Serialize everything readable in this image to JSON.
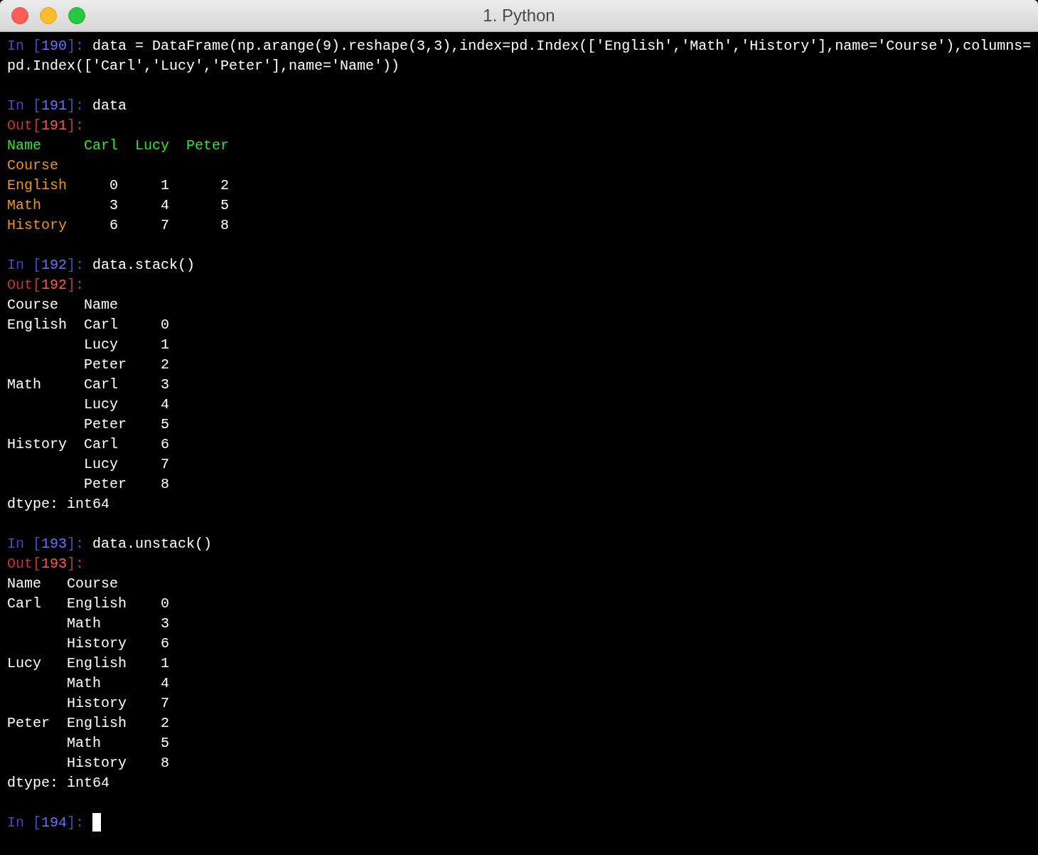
{
  "window": {
    "title": "1. Python"
  },
  "lines": [
    {
      "kind": "input",
      "prompt": [
        "In [",
        "190",
        "]:"
      ],
      "segments": [
        {
          "kind": "code",
          "text": "data = DataFrame(np.arange(9).reshape(3,3),index=pd.Index(['English','Math','History'],name='Course'),columns="
        }
      ]
    },
    {
      "kind": "text",
      "segments": [
        {
          "kind": "code",
          "text": "pd.Index(['Carl','Lucy','Peter'],name='Name'))"
        }
      ]
    },
    {
      "kind": "blank"
    },
    {
      "kind": "input",
      "prompt": [
        "In [",
        "191",
        "]:"
      ],
      "segments": [
        {
          "kind": "code",
          "text": "data"
        }
      ]
    },
    {
      "kind": "output",
      "prompt": [
        "Out[",
        "191",
        "]:"
      ]
    },
    {
      "kind": "text",
      "segments": [
        {
          "kind": "header",
          "text": "Name     Carl  Lucy  Peter"
        }
      ]
    },
    {
      "kind": "text",
      "segments": [
        {
          "kind": "index",
          "text": "Course"
        }
      ]
    },
    {
      "kind": "text",
      "segments": [
        {
          "kind": "index",
          "text": "English"
        },
        {
          "kind": "plain",
          "text": "     0     1      2"
        }
      ]
    },
    {
      "kind": "text",
      "segments": [
        {
          "kind": "index",
          "text": "Math"
        },
        {
          "kind": "plain",
          "text": "        3     4      5"
        }
      ]
    },
    {
      "kind": "text",
      "segments": [
        {
          "kind": "index",
          "text": "History"
        },
        {
          "kind": "plain",
          "text": "     6     7      8"
        }
      ]
    },
    {
      "kind": "blank"
    },
    {
      "kind": "input",
      "prompt": [
        "In [",
        "192",
        "]:"
      ],
      "segments": [
        {
          "kind": "code",
          "text": "data.stack()"
        }
      ]
    },
    {
      "kind": "output",
      "prompt": [
        "Out[",
        "192",
        "]:"
      ]
    },
    {
      "kind": "text",
      "segments": [
        {
          "kind": "plain",
          "text": "Course   Name"
        }
      ]
    },
    {
      "kind": "text",
      "segments": [
        {
          "kind": "plain",
          "text": "English  Carl     0"
        }
      ]
    },
    {
      "kind": "text",
      "segments": [
        {
          "kind": "plain",
          "text": "         Lucy     1"
        }
      ]
    },
    {
      "kind": "text",
      "segments": [
        {
          "kind": "plain",
          "text": "         Peter    2"
        }
      ]
    },
    {
      "kind": "text",
      "segments": [
        {
          "kind": "plain",
          "text": "Math     Carl     3"
        }
      ]
    },
    {
      "kind": "text",
      "segments": [
        {
          "kind": "plain",
          "text": "         Lucy     4"
        }
      ]
    },
    {
      "kind": "text",
      "segments": [
        {
          "kind": "plain",
          "text": "         Peter    5"
        }
      ]
    },
    {
      "kind": "text",
      "segments": [
        {
          "kind": "plain",
          "text": "History  Carl     6"
        }
      ]
    },
    {
      "kind": "text",
      "segments": [
        {
          "kind": "plain",
          "text": "         Lucy     7"
        }
      ]
    },
    {
      "kind": "text",
      "segments": [
        {
          "kind": "plain",
          "text": "         Peter    8"
        }
      ]
    },
    {
      "kind": "text",
      "segments": [
        {
          "kind": "plain",
          "text": "dtype: int64"
        }
      ]
    },
    {
      "kind": "blank"
    },
    {
      "kind": "input",
      "prompt": [
        "In [",
        "193",
        "]:"
      ],
      "segments": [
        {
          "kind": "code",
          "text": "data.unstack()"
        }
      ]
    },
    {
      "kind": "output",
      "prompt": [
        "Out[",
        "193",
        "]:"
      ]
    },
    {
      "kind": "text",
      "segments": [
        {
          "kind": "plain",
          "text": "Name   Course"
        }
      ]
    },
    {
      "kind": "text",
      "segments": [
        {
          "kind": "plain",
          "text": "Carl   English    0"
        }
      ]
    },
    {
      "kind": "text",
      "segments": [
        {
          "kind": "plain",
          "text": "       Math       3"
        }
      ]
    },
    {
      "kind": "text",
      "segments": [
        {
          "kind": "plain",
          "text": "       History    6"
        }
      ]
    },
    {
      "kind": "text",
      "segments": [
        {
          "kind": "plain",
          "text": "Lucy   English    1"
        }
      ]
    },
    {
      "kind": "text",
      "segments": [
        {
          "kind": "plain",
          "text": "       Math       4"
        }
      ]
    },
    {
      "kind": "text",
      "segments": [
        {
          "kind": "plain",
          "text": "       History    7"
        }
      ]
    },
    {
      "kind": "text",
      "segments": [
        {
          "kind": "plain",
          "text": "Peter  English    2"
        }
      ]
    },
    {
      "kind": "text",
      "segments": [
        {
          "kind": "plain",
          "text": "       Math       5"
        }
      ]
    },
    {
      "kind": "text",
      "segments": [
        {
          "kind": "plain",
          "text": "       History    8"
        }
      ]
    },
    {
      "kind": "text",
      "segments": [
        {
          "kind": "plain",
          "text": "dtype: int64"
        }
      ]
    },
    {
      "kind": "blank"
    },
    {
      "kind": "input",
      "prompt": [
        "In [",
        "194",
        "]:"
      ],
      "cursor": true
    }
  ]
}
